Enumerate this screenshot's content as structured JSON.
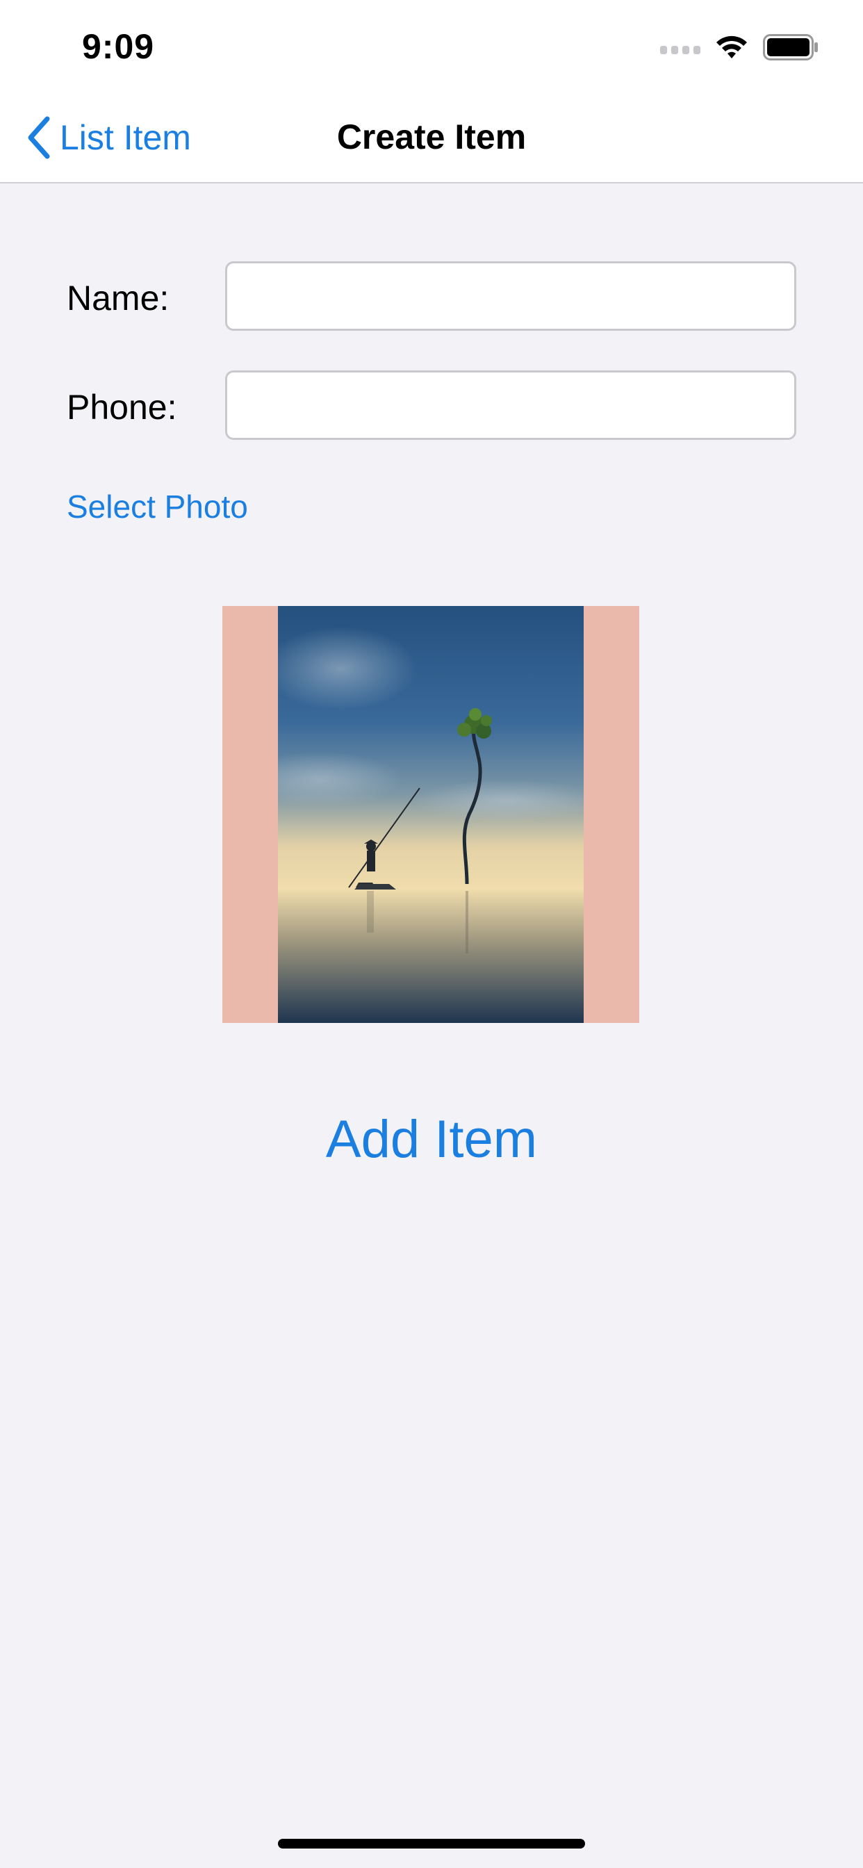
{
  "status_bar": {
    "time": "9:09",
    "icons": [
      "cellular-icon",
      "wifi-icon",
      "battery-icon"
    ]
  },
  "nav_bar": {
    "back_label": "List Item",
    "title": "Create Item"
  },
  "form": {
    "name_label": "Name:",
    "name_value": "",
    "phone_label": "Phone:",
    "phone_value": ""
  },
  "select_photo_label": "Select Photo",
  "photo": {
    "subject": "fisherman-on-boat-with-lone-tree-in-mist"
  },
  "add_item_label": "Add Item",
  "colors": {
    "accent": "#1a7fe0",
    "background": "#f2f2f7",
    "photo_frame": "#ebb9ab"
  }
}
